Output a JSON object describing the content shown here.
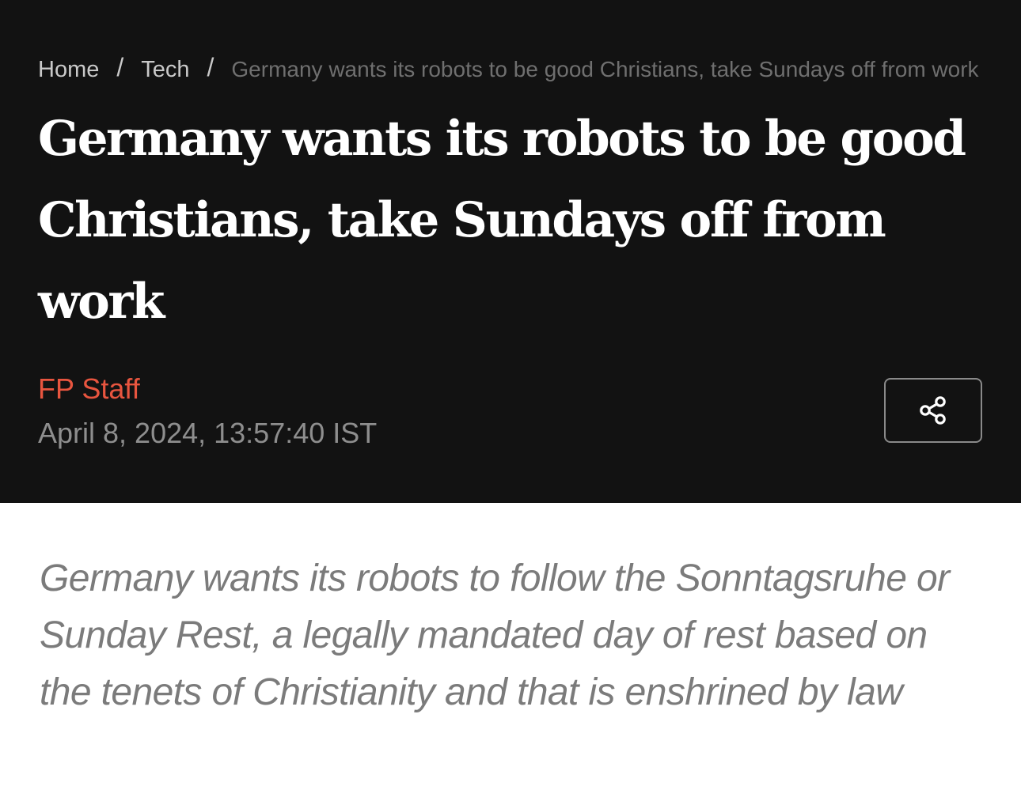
{
  "breadcrumb": {
    "home": "Home",
    "section": "Tech",
    "separator": "/",
    "current": "Germany wants its robots to be good Christians, take Sundays off from work"
  },
  "article": {
    "title": "Germany wants its robots to be good Christians, take Sundays off from work",
    "author": "FP Staff",
    "date": "April 8, 2024, 13:57:40 IST",
    "summary": "Germany wants its robots to follow the Sonntagsruhe or Sunday Rest, a legally mandated day of rest based on the tenets of Christianity and that is enshrined by law"
  },
  "share": {
    "icon": "share-icon"
  },
  "colors": {
    "hero_background": "#121212",
    "author_accent": "#e8553f",
    "summary_text": "#7b7b7b"
  }
}
